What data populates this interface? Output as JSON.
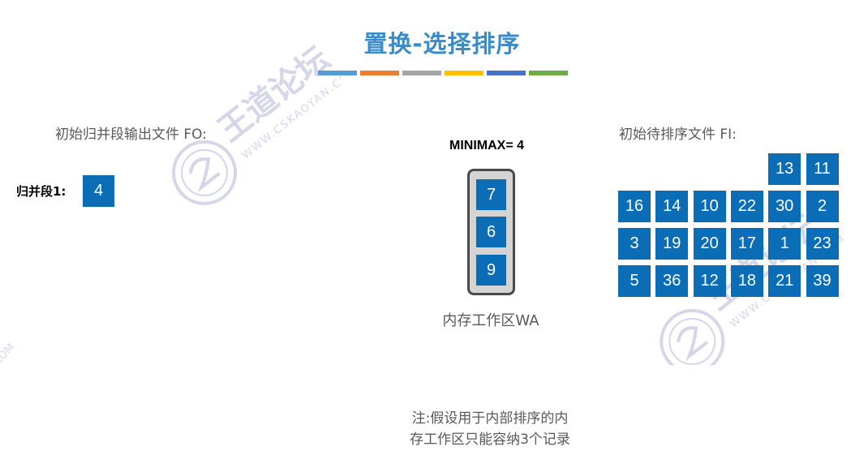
{
  "title": "置换-选择排序",
  "title_bar_colors": [
    "#5b9bd5",
    "#ed7d31",
    "#a5a5a5",
    "#ffc000",
    "#4472c4",
    "#70ad47"
  ],
  "cell_color": "#0b6db5",
  "output_file": {
    "heading": "初始归并段输出文件 FO:",
    "runs": [
      {
        "label": "归并段1:",
        "values": [
          "4"
        ]
      }
    ]
  },
  "working_area": {
    "minimax": "MINIMAX= 4",
    "values": [
      "7",
      "6",
      "9"
    ],
    "label": "内存工作区WA"
  },
  "input_file": {
    "heading": "初始待排序文件 FI:",
    "rows": [
      [
        "13",
        "11"
      ],
      [
        "16",
        "14",
        "10",
        "22",
        "30",
        "2"
      ],
      [
        "3",
        "19",
        "20",
        "17",
        "1",
        "23"
      ],
      [
        "5",
        "36",
        "12",
        "18",
        "21",
        "39"
      ]
    ]
  },
  "note": {
    "line1": "注:假设用于内部排序的内",
    "line2": "存工作区只能容纳3个记录"
  },
  "watermark": {
    "brand": "王道论坛",
    "url": "WWW.CSKAOYAN.COM"
  }
}
